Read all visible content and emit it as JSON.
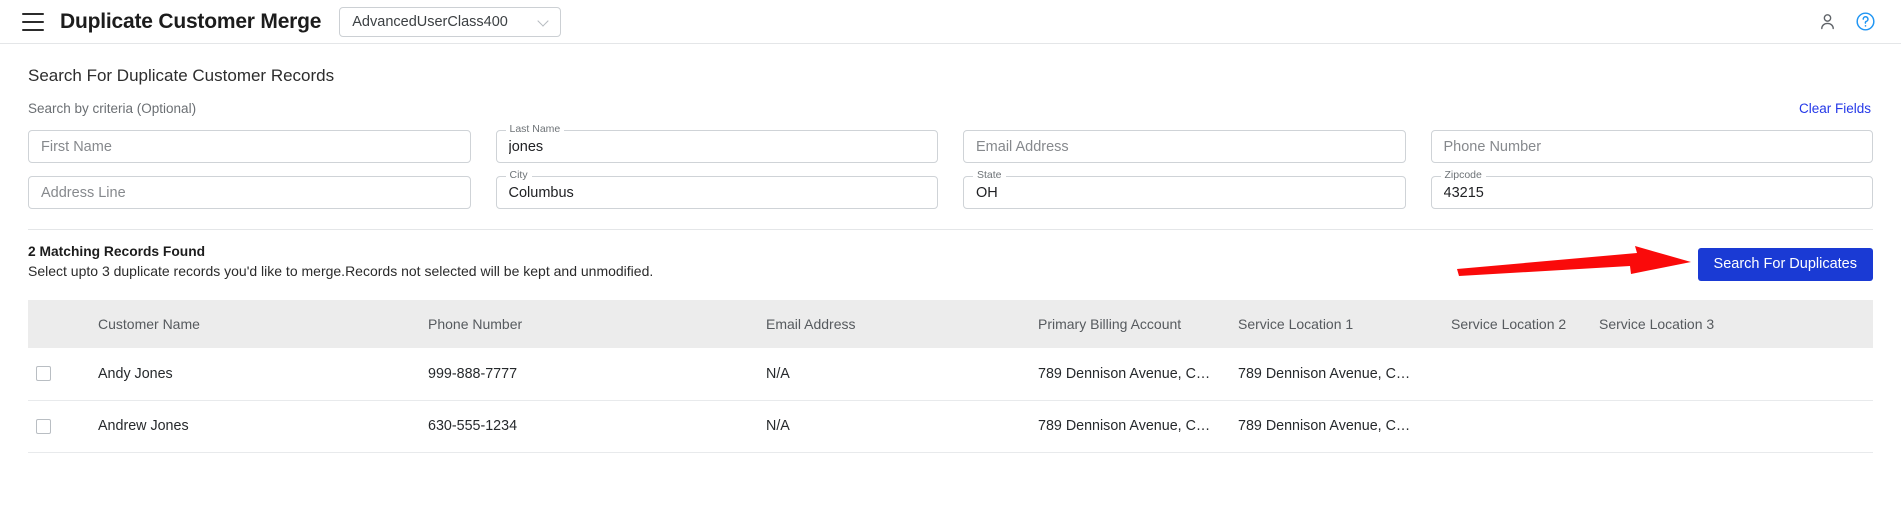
{
  "header": {
    "menu_icon": "hamburger-menu-icon",
    "title": "Duplicate Customer Merge",
    "user_class": "AdvancedUserClass400",
    "chevron_icon": "chevron-down-icon",
    "account_icon": "person-icon",
    "help_icon": "help-circle-icon",
    "help_color": "#2196f3"
  },
  "search": {
    "section_title": "Search For Duplicate Customer Records",
    "criteria_hint": "Search by criteria (Optional)",
    "clear_fields": "Clear Fields",
    "clear_fields_color": "#2438e8",
    "fields": [
      {
        "name": "first-name",
        "label": "First Name",
        "value": "",
        "placeholder": "First Name",
        "filled": false
      },
      {
        "name": "last-name",
        "label": "Last Name",
        "value": "jones",
        "placeholder": "Last Name",
        "filled": true
      },
      {
        "name": "email-address",
        "label": "Email Address",
        "value": "",
        "placeholder": "Email Address",
        "filled": false
      },
      {
        "name": "phone-number",
        "label": "Phone Number",
        "value": "",
        "placeholder": "Phone Number",
        "filled": false
      },
      {
        "name": "address-line",
        "label": "Address Line",
        "value": "",
        "placeholder": "Address Line",
        "filled": false
      },
      {
        "name": "city",
        "label": "City",
        "value": "Columbus",
        "placeholder": "City",
        "filled": true
      },
      {
        "name": "state",
        "label": "State",
        "value": "OH",
        "placeholder": "State",
        "filled": true
      },
      {
        "name": "zipcode",
        "label": "Zipcode",
        "value": "43215",
        "placeholder": "Zipcode",
        "filled": true
      }
    ]
  },
  "results": {
    "count_text": "2 Matching Records Found",
    "help_text": "Select upto 3 duplicate records you'd like to merge.Records not selected will be kept and unmodified.",
    "search_button": "Search For Duplicates",
    "button_color": "#1a3ad4",
    "annotation_arrow_color": "#fa0a0a"
  },
  "table": {
    "columns": [
      "",
      "Customer Name",
      "Phone Number",
      "Email Address",
      "Primary Billing Account",
      "Service Location 1",
      "Service Location 2",
      "Service Location 3"
    ],
    "rows": [
      {
        "selected": false,
        "customer_name": "Andy Jones",
        "phone_number": "999-888-7777",
        "email_address": "N/A",
        "primary_billing_account": "789 Dennison Avenue, C…",
        "service_location_1": "789 Dennison Avenue, C…",
        "service_location_2": "",
        "service_location_3": ""
      },
      {
        "selected": false,
        "customer_name": "Andrew Jones",
        "phone_number": "630-555-1234",
        "email_address": "N/A",
        "primary_billing_account": "789 Dennison Avenue, C…",
        "service_location_1": "789 Dennison Avenue, C…",
        "service_location_2": "",
        "service_location_3": ""
      }
    ]
  }
}
